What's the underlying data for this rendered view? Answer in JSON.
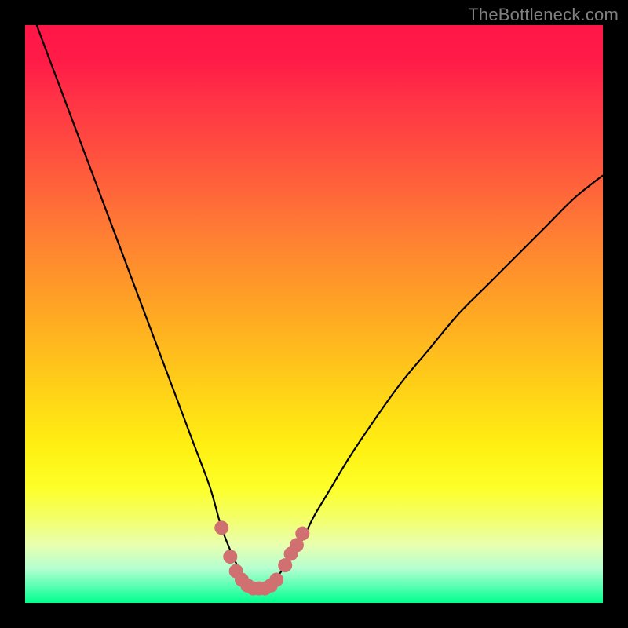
{
  "watermark": "TheBottleneck.com",
  "chart_data": {
    "type": "line",
    "title": "",
    "xlabel": "",
    "ylabel": "",
    "xlim": [
      0,
      100
    ],
    "ylim": [
      0,
      100
    ],
    "series": [
      {
        "name": "bottleneck-curve",
        "x": [
          2,
          5,
          8,
          11,
          14,
          17,
          20,
          23,
          26,
          29,
          32,
          34,
          36,
          37.5,
          39,
          40,
          41,
          42,
          44,
          46,
          48,
          50,
          53,
          56,
          60,
          65,
          70,
          75,
          80,
          85,
          90,
          95,
          100
        ],
        "y": [
          100,
          92,
          84,
          76,
          68,
          60,
          52,
          44,
          36,
          28,
          20,
          13,
          8,
          5,
          3,
          2.5,
          2.5,
          3,
          5,
          8,
          11,
          15,
          20,
          25,
          31,
          38,
          44,
          50,
          55,
          60,
          65,
          70,
          74
        ]
      }
    ],
    "markers": {
      "name": "highlighted-range",
      "color": "#d07070",
      "points": [
        {
          "x": 34,
          "y": 13
        },
        {
          "x": 35.5,
          "y": 8
        },
        {
          "x": 36.5,
          "y": 5.5
        },
        {
          "x": 37.5,
          "y": 4
        },
        {
          "x": 38.5,
          "y": 3
        },
        {
          "x": 39.5,
          "y": 2.5
        },
        {
          "x": 40.5,
          "y": 2.5
        },
        {
          "x": 41.5,
          "y": 2.5
        },
        {
          "x": 42.5,
          "y": 3
        },
        {
          "x": 43.5,
          "y": 4
        },
        {
          "x": 45,
          "y": 6.5
        },
        {
          "x": 46,
          "y": 8.5
        },
        {
          "x": 47,
          "y": 10
        },
        {
          "x": 48,
          "y": 12
        }
      ]
    }
  }
}
